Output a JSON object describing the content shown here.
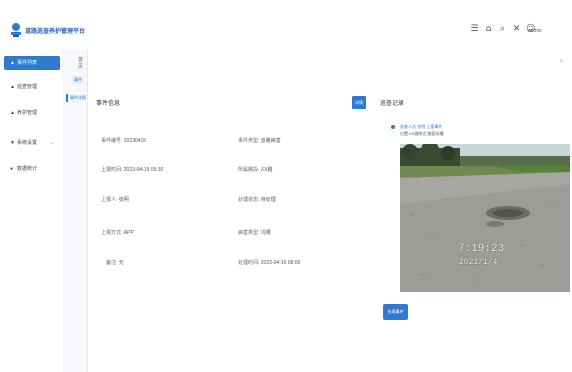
{
  "header": {
    "app_title": "道路巡查养护管理平台",
    "tools": [
      "☰",
      "⌂",
      "⌕",
      "✕",
      "☺"
    ],
    "user_name": "admin"
  },
  "sidebar": {
    "items": [
      {
        "label": "事件列表",
        "icon": "home-icon",
        "active": true
      },
      {
        "label": "巡查管理",
        "icon": "user-icon",
        "active": false
      },
      {
        "label": "养护管理",
        "icon": "user-icon",
        "active": false
      },
      {
        "label": "系统设置",
        "icon": "gear-icon",
        "active": false,
        "has_arrow": true
      },
      {
        "label": "数据统计",
        "icon": "chart-icon",
        "active": false
      }
    ]
  },
  "subnav": {
    "label": "首页",
    "tab": "事件",
    "active_item": "事件详情"
  },
  "detail": {
    "section_title": "事件信息",
    "fields": [
      {
        "label": "事件编号:",
        "value": "20230415"
      },
      {
        "label": "事件类型:",
        "value": "道路病害"
      },
      {
        "label": "上报时间:",
        "value": "2023-04-15 09:30"
      },
      {
        "label": "所属路段:",
        "value": "XX路"
      },
      {
        "label": "上报人:",
        "value": "张明"
      },
      {
        "label": "处理状态:",
        "value": "待处理"
      },
      {
        "label": "上报方式:",
        "value": "APP"
      },
      {
        "label": "病害类型:",
        "value": "坑槽"
      },
      {
        "label": "备注:",
        "value": "无"
      },
      {
        "label": "处理时间:",
        "value": "2023-04-16 08:00"
      }
    ]
  },
  "record": {
    "tag_button": "详情",
    "section_title": "巡查记录",
    "entry_title": "巡查人员 张明 上报事件",
    "entry_subtitle": "位置:XX路附近 路面坑槽",
    "photo_time": "7:19:23",
    "photo_date": "2021/1/4",
    "action_button": "处理事件"
  },
  "colors": {
    "accent": "#2e7ad1",
    "sidebar_active_bg": "#2e7ad1",
    "subnav_bg": "#f6f8fb"
  }
}
